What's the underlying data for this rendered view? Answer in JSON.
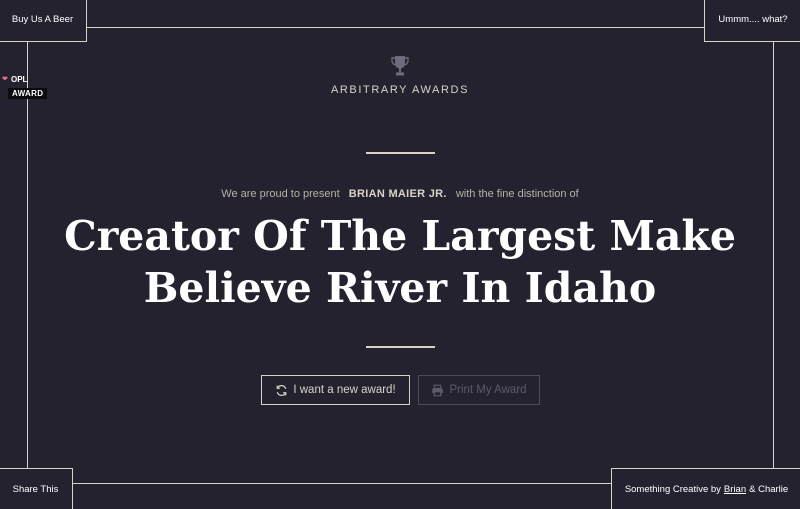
{
  "corners": {
    "top_left": "Buy Us A Beer",
    "top_right": "Ummm.... what?",
    "bottom_left": "Share This",
    "bottom_right_prefix": "Something Creative by",
    "bottom_right_link": "Brian",
    "bottom_right_suffix": "& Charlie"
  },
  "badge": {
    "line1": "OPL",
    "line2": "AWARD",
    "heart_icon": "heart-icon"
  },
  "header": {
    "brand": "ARBITRARY AWARDS",
    "icon": "trophy-icon"
  },
  "intro": {
    "prefix": "We are proud to present",
    "recipient": "BRIAN MAIER JR.",
    "suffix": "with the fine distinction of"
  },
  "award": {
    "line1": "Creator Of The Largest Make",
    "line2": "Believe River In Idaho"
  },
  "buttons": {
    "new_award": "I want a new award!",
    "print": "Print My Award"
  },
  "colors": {
    "background": "#252230",
    "frame": "#d8d3c6",
    "text": "#ffffff",
    "muted": "#b7b2a6",
    "disabled": "#5d596a",
    "heart": "#e9748b"
  }
}
